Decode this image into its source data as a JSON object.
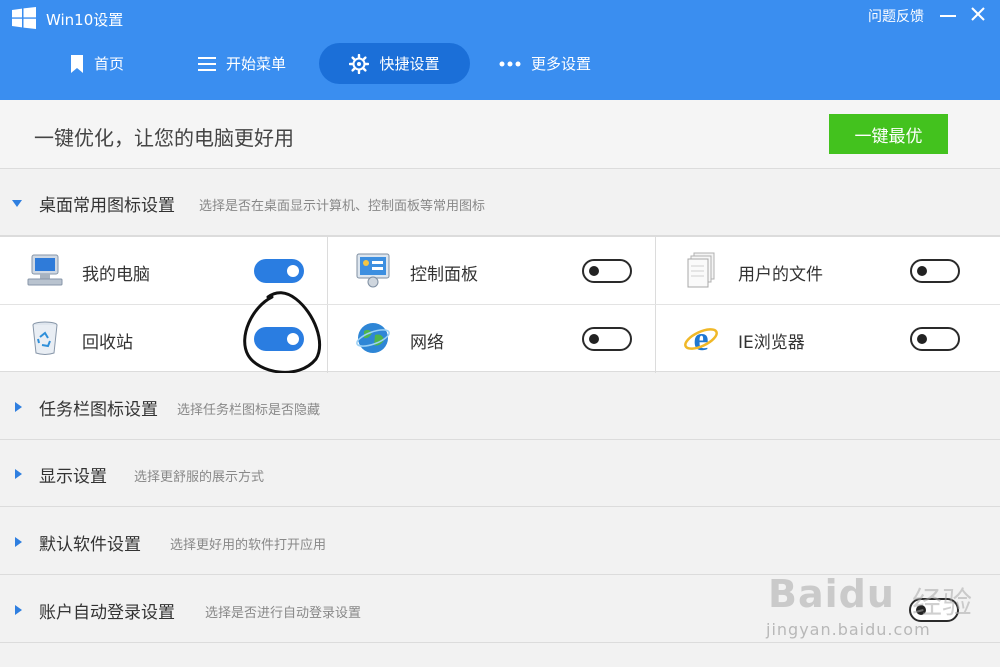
{
  "window": {
    "title": "Win10设置",
    "feedback_label": "问题反馈"
  },
  "nav": {
    "tabs": [
      {
        "label": "首页",
        "icon": "bookmark-icon"
      },
      {
        "label": "开始菜单",
        "icon": "menu-icon"
      },
      {
        "label": "快捷设置",
        "icon": "gear-icon",
        "active": true
      },
      {
        "label": "更多设置",
        "icon": "more-icon"
      }
    ]
  },
  "optimize": {
    "text": "一键优化，让您的电脑更好用",
    "button_label": "一键最优"
  },
  "sections": [
    {
      "title": "桌面常用图标设置",
      "desc": "选择是否在桌面显示计算机、控制面板等常用图标",
      "expanded": true
    },
    {
      "title": "任务栏图标设置",
      "desc": "选择任务栏图标是否隐藏",
      "expanded": false
    },
    {
      "title": "显示设置",
      "desc": "选择更舒服的展示方式",
      "expanded": false
    },
    {
      "title": "默认软件设置",
      "desc": "选择更好用的软件打开应用",
      "expanded": false
    },
    {
      "title": "账户自动登录设置",
      "desc": "选择是否进行自动登录设置",
      "expanded": false
    }
  ],
  "desktop_icons": [
    {
      "label": "我的电脑",
      "icon": "computer-icon",
      "enabled": true
    },
    {
      "label": "控制面板",
      "icon": "control-panel-icon",
      "enabled": false
    },
    {
      "label": "用户的文件",
      "icon": "user-files-icon",
      "enabled": false
    },
    {
      "label": "回收站",
      "icon": "recycle-bin-icon",
      "enabled": true
    },
    {
      "label": "网络",
      "icon": "network-icon",
      "enabled": false
    },
    {
      "label": "IE浏览器",
      "icon": "ie-browser-icon",
      "enabled": false
    }
  ],
  "watermark": {
    "logo": "Baidu",
    "brand_cn": "经验",
    "url": "jingyan.baidu.com"
  },
  "colors": {
    "accent": "#3a8ef0",
    "nav_active": "#1b6fd8",
    "toggle_on": "#2a7de1",
    "optimize_button": "#43c21e"
  }
}
